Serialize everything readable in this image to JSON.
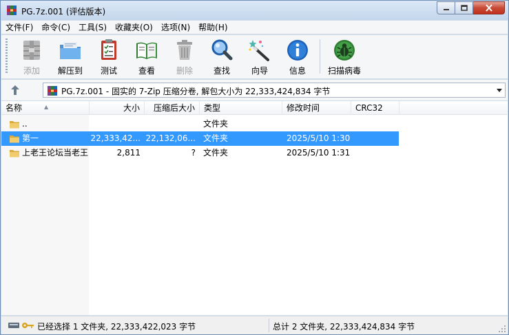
{
  "window": {
    "title": "PG.7z.001 (评估版本)"
  },
  "menu": [
    {
      "label": "文件(F)"
    },
    {
      "label": "命令(C)"
    },
    {
      "label": "工具(S)"
    },
    {
      "label": "收藏夹(O)"
    },
    {
      "label": "选项(N)"
    },
    {
      "label": "帮助(H)"
    }
  ],
  "toolbar": {
    "buttons": [
      {
        "label": "添加",
        "icon": "archive-add-icon",
        "enabled": false
      },
      {
        "label": "解压到",
        "icon": "extract-folder-icon",
        "enabled": true
      },
      {
        "label": "测试",
        "icon": "test-checklist-icon",
        "enabled": true
      },
      {
        "label": "查看",
        "icon": "view-book-icon",
        "enabled": true
      },
      {
        "label": "删除",
        "icon": "delete-trash-icon",
        "enabled": false
      },
      {
        "label": "查找",
        "icon": "find-magnifier-icon",
        "enabled": true
      },
      {
        "label": "向导",
        "icon": "wizard-wand-icon",
        "enabled": true
      },
      {
        "label": "信息",
        "icon": "info-icon",
        "enabled": true
      },
      {
        "label": "扫描病毒",
        "icon": "virus-scan-icon",
        "enabled": true
      }
    ]
  },
  "address": {
    "text": "PG.7z.001 - 固实的 7-Zip 压缩分卷, 解包大小为 22,333,424,834 字节"
  },
  "columns": {
    "name": "名称",
    "size": "大小",
    "packed": "压缩后大小",
    "type": "类型",
    "modified": "修改时间",
    "crc": "CRC32"
  },
  "files": [
    {
      "name": "..",
      "size": "",
      "packed": "",
      "type": "文件夹",
      "modified": "",
      "crc": "",
      "selected": false
    },
    {
      "name": "第一",
      "size": "22,333,42...",
      "packed": "22,132,06...",
      "type": "文件夹",
      "modified": "2025/5/10 1:30",
      "crc": "",
      "selected": true
    },
    {
      "name": "上老王论坛当老王",
      "size": "2,811",
      "packed": "?",
      "type": "文件夹",
      "modified": "2025/5/10 1:31",
      "crc": "",
      "selected": false
    }
  ],
  "status": {
    "left": "已经选择 1 文件夹, 22,333,422,023 字节",
    "right": "总计 2 文件夹, 22,333,424,834 字节"
  },
  "colors": {
    "selection": "#3399ff",
    "folder": "#e8c15a",
    "window_frame": "#cfdcec"
  }
}
